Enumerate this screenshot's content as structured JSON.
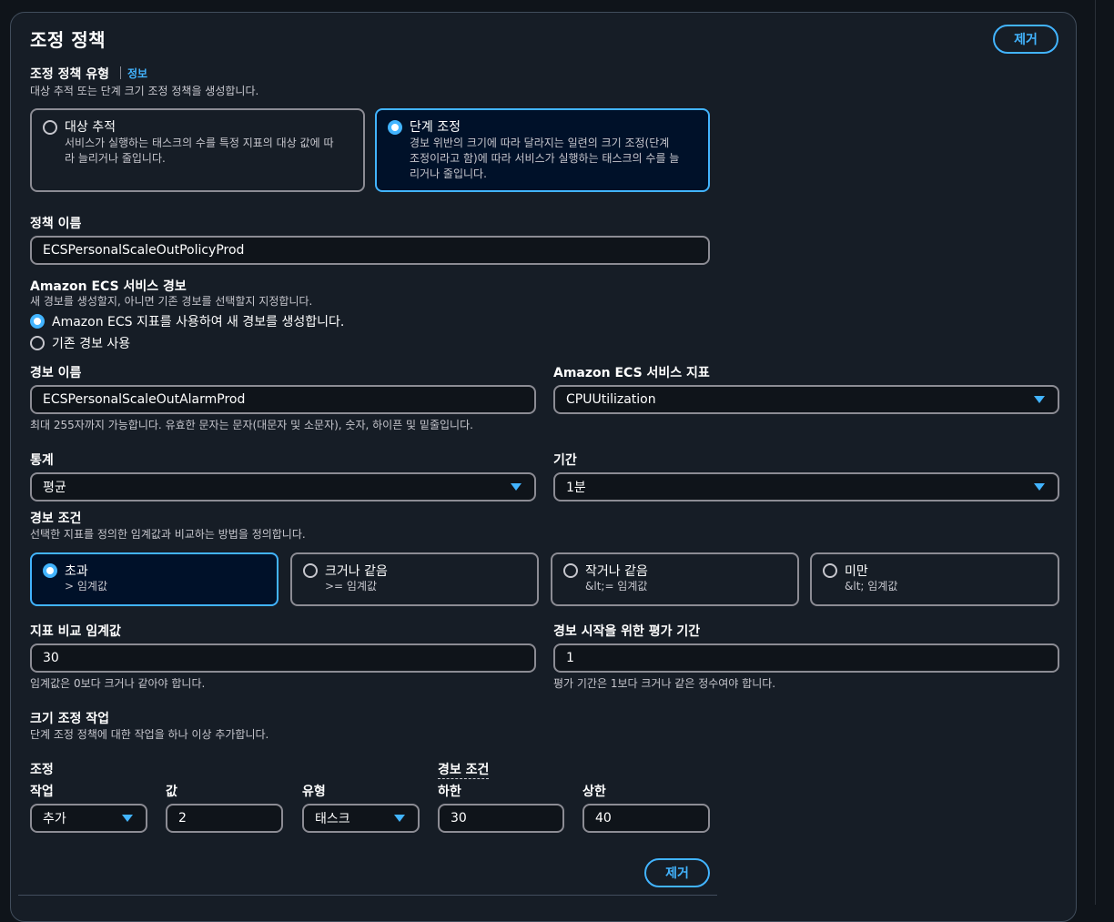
{
  "section": {
    "title": "조정 정책",
    "remove_label": "제거"
  },
  "policy_type": {
    "label": "조정 정책 유형",
    "info": "정보",
    "description": "대상 추적 또는 단계 크기 조정 정책을 생성합니다.",
    "options": [
      {
        "title": "대상 추적",
        "desc_line1": "서비스가 실행하는 태스크의 수를 특정 지표의 대상 값에 따",
        "desc_line2": "라 늘리거나 줄입니다.",
        "selected": false
      },
      {
        "title": "단계 조정",
        "desc_line1": "경보 위반의 크기에 따라 달라지는 일련의 크기 조정(단계",
        "desc_line2": "조정이라고 함)에 따라 서비스가 실행하는 태스크의 수를 늘",
        "desc_line3": "리거나 줄입니다.",
        "selected": true
      }
    ]
  },
  "policy_name": {
    "label": "정책 이름",
    "value": "ECSPersonalScaleOutPolicyProd"
  },
  "service_alarm": {
    "label": "Amazon ECS 서비스 경보",
    "description": "새 경보를 생성할지, 아니면 기존 경보를 선택할지 지정합니다.",
    "options": [
      {
        "label": "Amazon ECS 지표를 사용하여 새 경보를 생성합니다.",
        "selected": true
      },
      {
        "label": "기존 경보 사용",
        "selected": false
      }
    ]
  },
  "alarm_name": {
    "label": "경보 이름",
    "value": "ECSPersonalScaleOutAlarmProd",
    "hint": "최대 255자까지 가능합니다. 유효한 문자는 문자(대문자 및 소문자), 숫자, 하이픈 및 밑줄입니다."
  },
  "metric": {
    "label": "Amazon ECS 서비스 지표",
    "value": "CPUUtilization"
  },
  "statistic": {
    "label": "통계",
    "value": "평균"
  },
  "period": {
    "label": "기간",
    "value": "1분"
  },
  "alarm_condition": {
    "label": "경보 조건",
    "description": "선택한 지표를 정의한 임계값과 비교하는 방법을 정의합니다.",
    "options": [
      {
        "title": "초과",
        "desc": "> 임계값",
        "selected": true
      },
      {
        "title": "크거나 같음",
        "desc": ">= 임계값",
        "selected": false
      },
      {
        "title": "작거나 같음",
        "desc": "&lt;= 임계값",
        "selected": false
      },
      {
        "title": "미만",
        "desc": "&lt; 임계값",
        "selected": false
      }
    ]
  },
  "threshold": {
    "label": "지표 비교 임계값",
    "value": "30",
    "hint": "임계값은 0보다 크거나 같아야 합니다."
  },
  "eval_periods": {
    "label": "경보 시작을 위한 평가 기간",
    "value": "1",
    "hint": "평가 기간은 1보다 크거나 같은 정수여야 합니다."
  },
  "scaling_actions": {
    "label": "크기 조정 작업",
    "description": "단계 조정 정책에 대한 작업을 하나 이상 추가합니다.",
    "group_adjust": "조정",
    "group_condition": "경보 조건",
    "columns": {
      "action": "작업",
      "value": "값",
      "type": "유형",
      "lower": "하한",
      "upper": "상한"
    },
    "row": {
      "action": "추가",
      "value": "2",
      "type": "태스크",
      "lower": "30",
      "upper": "40"
    },
    "remove_label": "제거"
  },
  "colors": {
    "accent": "#42b4ff",
    "panel_bg": "#161d26",
    "page_bg": "#0f141a",
    "selected_tile_bg": "#001129",
    "border": "#8c8c94"
  }
}
